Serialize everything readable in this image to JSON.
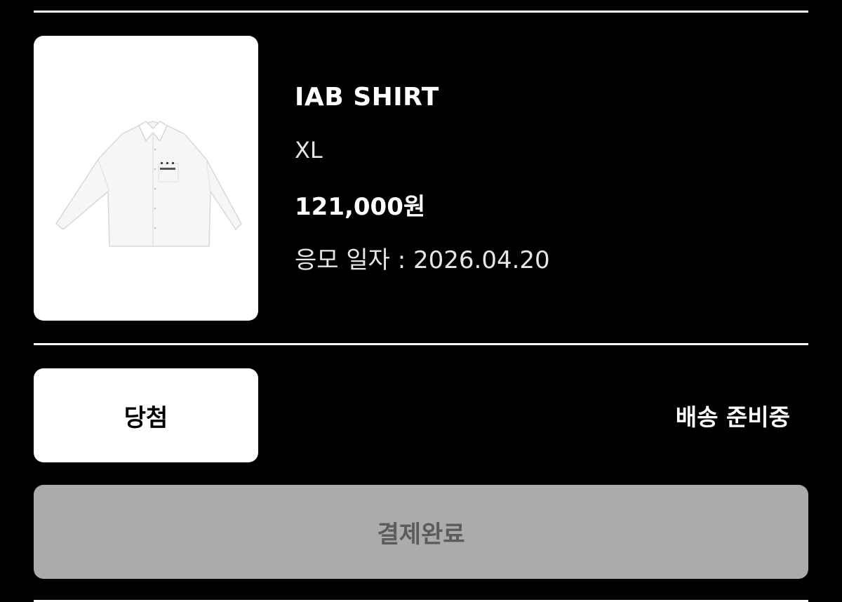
{
  "product": {
    "name": "IAB SHIRT",
    "size": "XL",
    "price": "121,000원",
    "apply_date": "응모 일자 : 2026.04.20",
    "image_icon": "white-shirt-image"
  },
  "status": {
    "result_label": "당첨",
    "shipping_label": "배송 준비중"
  },
  "actions": {
    "payment_label": "결제완료"
  },
  "colors": {
    "background": "#000000",
    "card": "#ffffff",
    "disabled_button": "#ababab",
    "disabled_text": "#5c5c5c"
  }
}
